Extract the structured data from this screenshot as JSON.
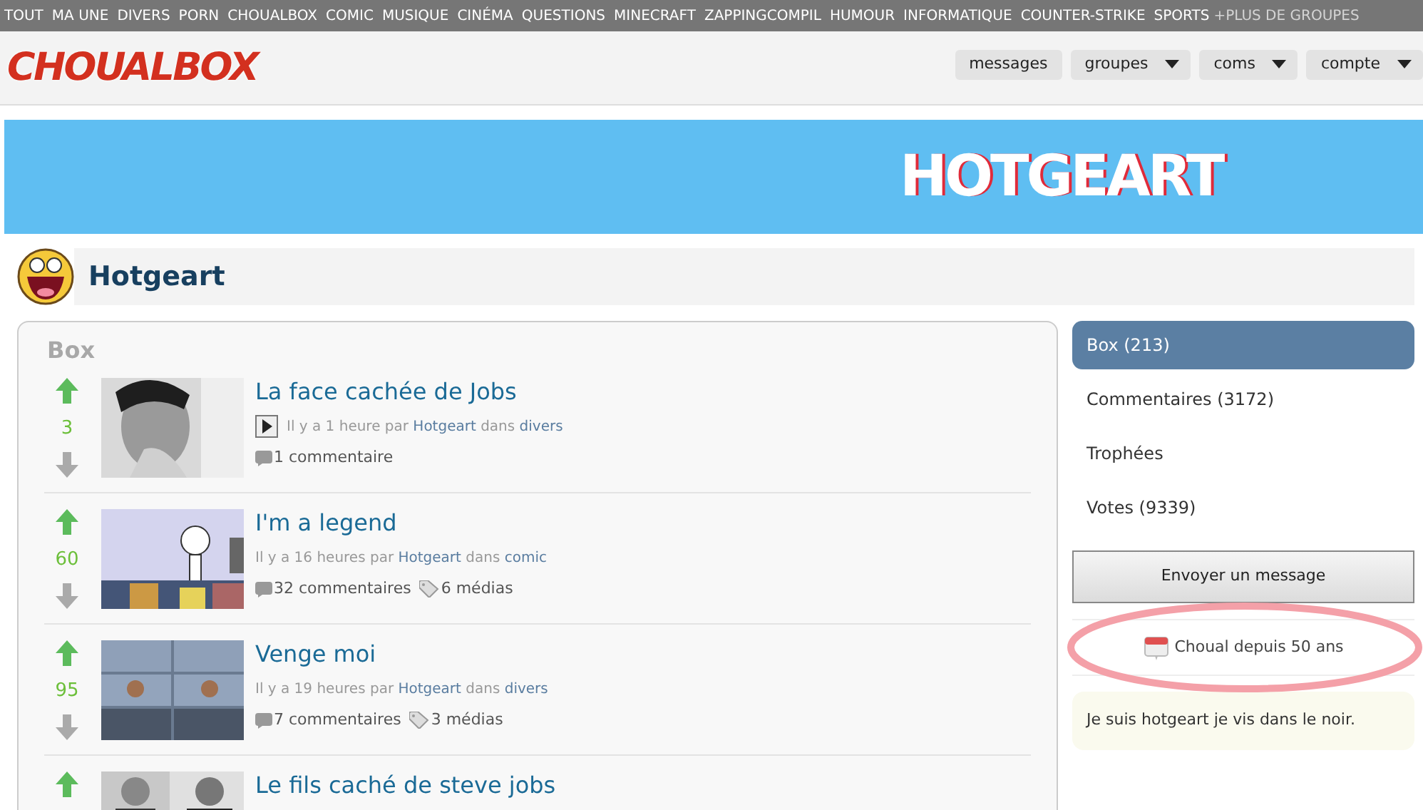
{
  "top_nav": {
    "links": [
      "TOUT",
      "MA UNE",
      "DIVERS",
      "PORN",
      "CHOUALBOX",
      "COMIC",
      "MUSIQUE",
      "CINÉMA",
      "QUESTIONS",
      "MINECRAFT",
      "ZAPPINGCOMPIL",
      "HUMOUR",
      "INFORMATIQUE",
      "COUNTER-STRIKE",
      "SPORTS"
    ],
    "more": "+PLUS DE GROUPES"
  },
  "header": {
    "logo": "CHOUALBOX",
    "buttons": [
      {
        "label": "messages",
        "dropdown": false
      },
      {
        "label": "groupes",
        "dropdown": true
      },
      {
        "label": "coms",
        "dropdown": true
      },
      {
        "label": "compte",
        "dropdown": true
      }
    ]
  },
  "banner": {
    "title": "HOTGEART"
  },
  "profile": {
    "name": "Hotgeart"
  },
  "box": {
    "heading": "Box",
    "items": [
      {
        "title": "La face cachée de Jobs",
        "score": "3",
        "video": true,
        "time": "Il y a 1 heure par",
        "author": "Hotgeart",
        "in": "dans",
        "category": "divers",
        "comments": "1 commentaire"
      },
      {
        "title": "I'm a legend",
        "score": "60",
        "video": false,
        "time": "Il y a 16 heures par",
        "author": "Hotgeart",
        "in": "dans",
        "category": "comic",
        "comments": "32 commentaires",
        "medias": "6 médias"
      },
      {
        "title": "Venge moi",
        "score": "95",
        "video": false,
        "time": "Il y a 19 heures par",
        "author": "Hotgeart",
        "in": "dans",
        "category": "divers",
        "comments": "7 commentaires",
        "medias": "3 médias"
      },
      {
        "title": "Le fils caché de steve jobs"
      }
    ]
  },
  "sidebar": {
    "tabs": [
      {
        "label": "Box (213)",
        "selected": true
      },
      {
        "label": "Commentaires (3172)",
        "selected": false
      },
      {
        "label": "Trophées",
        "selected": false
      },
      {
        "label": "Votes (9339)",
        "selected": false
      }
    ],
    "button": "Envoyer un message",
    "since": "Choual depuis 50 ans",
    "since_highlighted": true,
    "bio": "Je suis hotgeart je vis dans le noir."
  }
}
